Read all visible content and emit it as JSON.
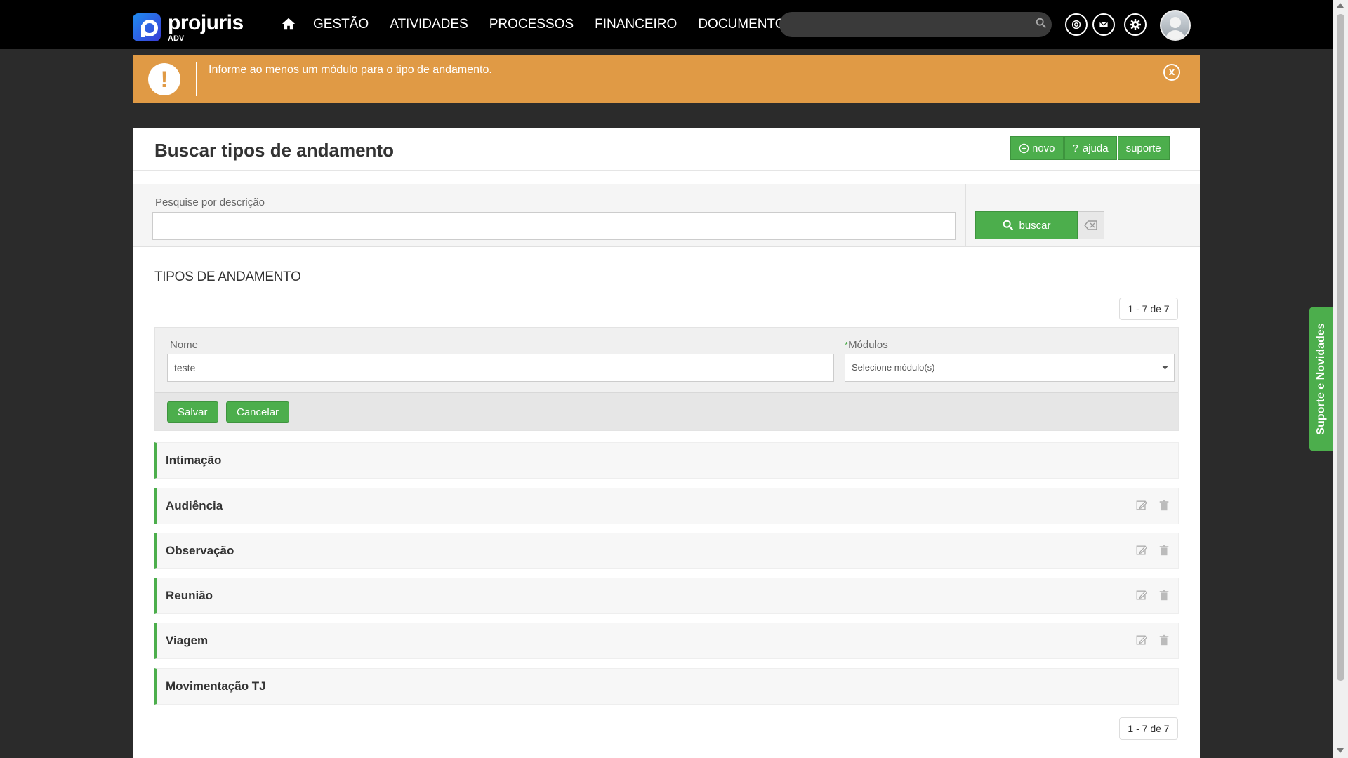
{
  "brand": {
    "name": "projuris",
    "sub": "ADV"
  },
  "nav": {
    "items": [
      {
        "label": "GESTÃO"
      },
      {
        "label": "ATIVIDADES"
      },
      {
        "label": "PROCESSOS"
      },
      {
        "label": "FINANCEIRO"
      },
      {
        "label": "DOCUMENTOS"
      }
    ],
    "search_placeholder": ""
  },
  "alert": {
    "message": "Informe ao menos um módulo para o tipo de andamento.",
    "icon": "!",
    "close": "x",
    "color": "#e09a45"
  },
  "page": {
    "title": "Buscar tipos de andamento",
    "buttons": {
      "novo": "novo",
      "ajuda": "ajuda",
      "suporte": "suporte"
    }
  },
  "search": {
    "label": "Pesquise por descrição",
    "value": "",
    "button": "buscar"
  },
  "section": {
    "title": "TIPOS DE ANDAMENTO",
    "pager_top": "1 - 7 de 7",
    "pager_bottom": "1 - 7 de 7"
  },
  "form": {
    "nome_label": "Nome",
    "nome_value": "teste",
    "modulos_label": "Módulos",
    "modulos_required": "*",
    "modulos_placeholder": "Selecione módulo(s)",
    "save": "Salvar",
    "cancel": "Cancelar"
  },
  "rows": [
    {
      "label": "Intimação",
      "actions": false
    },
    {
      "label": "Audiência",
      "actions": true
    },
    {
      "label": "Observação",
      "actions": true
    },
    {
      "label": "Reunião",
      "actions": true
    },
    {
      "label": "Viagem",
      "actions": true
    },
    {
      "label": "Movimentação TJ",
      "actions": false
    }
  ],
  "side_tab": {
    "label": "Suporte e Novidades"
  },
  "colors": {
    "accent": "#4cae4c",
    "topbar": "#000000",
    "warning": "#e09a45"
  }
}
